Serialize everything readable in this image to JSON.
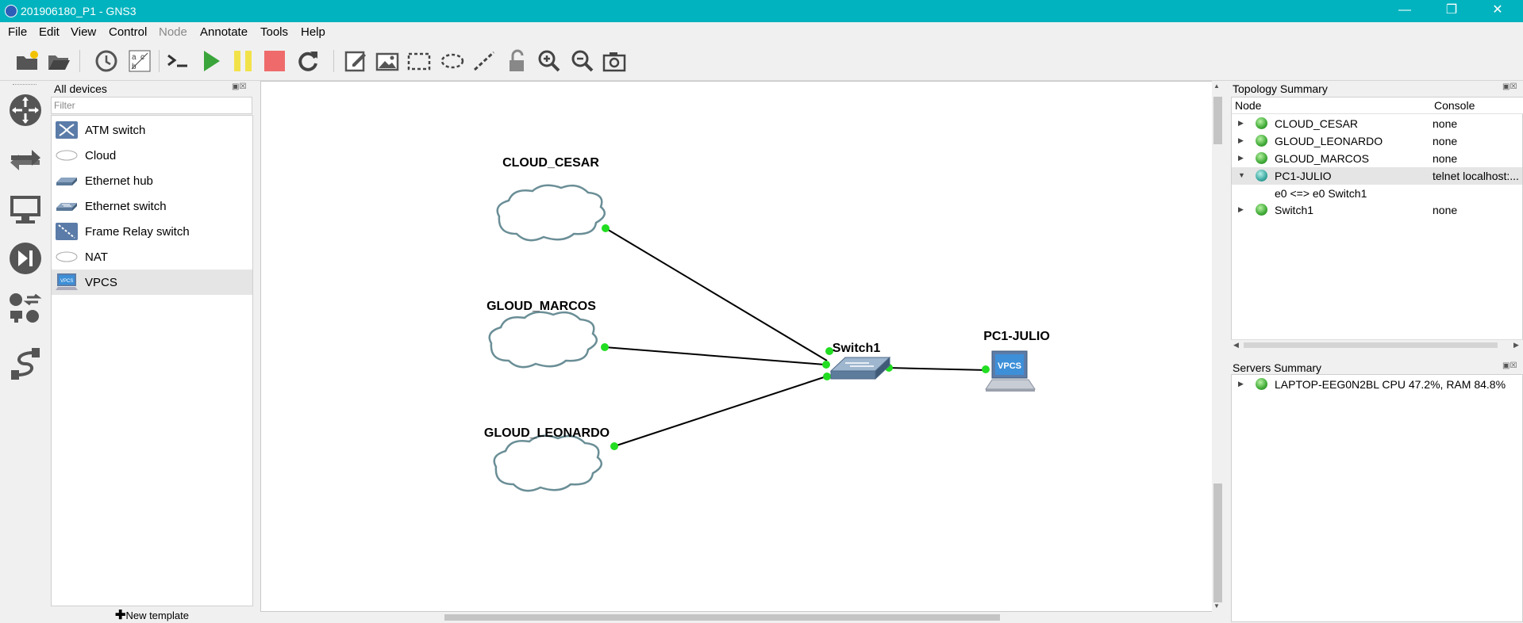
{
  "window": {
    "title": "201906180_P1 - GNS3",
    "controls": [
      "minimize-icon",
      "restore-icon",
      "close-icon"
    ]
  },
  "menu": {
    "items": [
      {
        "label": "File",
        "enabled": true
      },
      {
        "label": "Edit",
        "enabled": true
      },
      {
        "label": "View",
        "enabled": true
      },
      {
        "label": "Control",
        "enabled": true
      },
      {
        "label": "Node",
        "enabled": false
      },
      {
        "label": "Annotate",
        "enabled": true
      },
      {
        "label": "Tools",
        "enabled": true
      },
      {
        "label": "Help",
        "enabled": true
      }
    ]
  },
  "toolbar": {
    "buttons": [
      "new-project-icon",
      "open-project-icon",
      "snapshot-icon",
      "show-interface-labels-icon",
      "console-all-icon",
      "start-all-icon",
      "suspend-all-icon",
      "stop-all-icon",
      "reload-all-icon",
      "add-note-icon",
      "insert-picture-icon",
      "draw-rectangle-icon",
      "draw-ellipse-icon",
      "draw-line-icon",
      "lock-unlock-icon",
      "zoom-in-icon",
      "zoom-out-icon",
      "screenshot-icon"
    ],
    "colors": {
      "start": "#3aa53a",
      "suspend": "#f2e24a",
      "stop": "#ef6b6b"
    }
  },
  "left_strip": {
    "buttons": [
      "routers-icon",
      "switches-icon",
      "end-devices-icon",
      "security-devices-icon",
      "all-devices-icon",
      "add-link-icon"
    ]
  },
  "devices_panel": {
    "title": "All devices",
    "filter_placeholder": "Filter",
    "items": [
      {
        "label": "ATM switch",
        "icon": "atm-switch-icon"
      },
      {
        "label": "Cloud",
        "icon": "cloud-icon"
      },
      {
        "label": "Ethernet hub",
        "icon": "ethernet-hub-icon"
      },
      {
        "label": "Ethernet switch",
        "icon": "ethernet-switch-icon"
      },
      {
        "label": "Frame Relay switch",
        "icon": "frame-relay-switch-icon"
      },
      {
        "label": "NAT",
        "icon": "nat-icon"
      },
      {
        "label": "VPCS",
        "icon": "vpcs-icon",
        "selected": true
      }
    ],
    "new_template": "New template"
  },
  "topology": {
    "nodes": [
      {
        "id": "cloud_cesar",
        "label": "CLOUD_CESAR",
        "type": "cloud"
      },
      {
        "id": "gloud_marcos",
        "label": "GLOUD_MARCOS",
        "type": "cloud"
      },
      {
        "id": "gloud_leonardo",
        "label": "GLOUD_LEONARDO",
        "type": "cloud"
      },
      {
        "id": "switch1",
        "label": "Switch1",
        "type": "ethernet-switch"
      },
      {
        "id": "pc1",
        "label": "PC1-JULIO",
        "type": "vpcs",
        "screen_text": "VPCS"
      }
    ],
    "links": [
      {
        "from": "cloud_cesar",
        "to": "switch1",
        "status": "up"
      },
      {
        "from": "gloud_marcos",
        "to": "switch1",
        "status": "up"
      },
      {
        "from": "gloud_leonardo",
        "to": "switch1",
        "status": "up"
      },
      {
        "from": "switch1",
        "to": "pc1",
        "status": "up"
      }
    ],
    "link_status_color": "#22dd22"
  },
  "topology_summary": {
    "title": "Topology Summary",
    "columns": [
      "Node",
      "Console"
    ],
    "rows": [
      {
        "name": "CLOUD_CESAR",
        "console": "none",
        "expanded": false
      },
      {
        "name": "GLOUD_LEONARDO",
        "console": "none",
        "expanded": false
      },
      {
        "name": "GLOUD_MARCOS",
        "console": "none",
        "expanded": false
      },
      {
        "name": "PC1-JULIO",
        "console": "telnet localhost:...",
        "expanded": true,
        "children": [
          "e0 <=> e0 Switch1"
        ]
      },
      {
        "name": "Switch1",
        "console": "none",
        "expanded": false
      }
    ]
  },
  "servers_summary": {
    "title": "Servers Summary",
    "rows": [
      {
        "text": "LAPTOP-EEG0N2BL CPU 47.2%, RAM 84.8%"
      }
    ]
  }
}
